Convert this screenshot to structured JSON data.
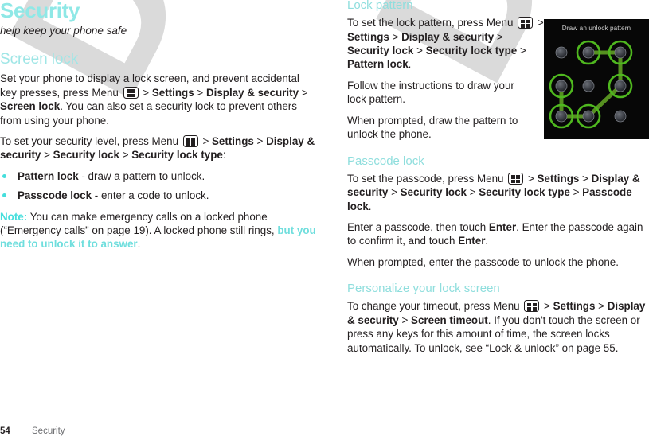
{
  "doc": {
    "title": "Security",
    "subtitle": "help keep your phone safe",
    "watermark": "DRAFT"
  },
  "colors": {
    "title_teal": "#8fe8e6",
    "section_teal": "#9fe6e6",
    "subsection_teal": "#8fdedd",
    "note_teal": "#45dedc",
    "bullet_teal": "#45dedc",
    "body_text": "#231f20",
    "footer_gray": "#6d6e71",
    "watermark_gray": "#d9d9d9",
    "figure_background": "#070707",
    "figure_green": "#6cb32a"
  },
  "icons": {
    "menu_key": "menu-key-icon"
  },
  "left_column": {
    "section_heading": "Screen lock",
    "paragraph_1": {
      "part_1": "Set your phone to display a lock screen, and prevent accidental key presses, press Menu ",
      "gt_1": " > ",
      "bold_1": "Settings",
      "gt_2": " > ",
      "bold_2": "Display & security",
      "gt_3": " > ",
      "bold_3": "Screen lock",
      "part_2": ". You can also set a security lock to prevent others from using your phone."
    },
    "paragraph_2": {
      "part_1": "To set your security level, press Menu ",
      "gt_1": " > ",
      "bold_1": "Settings",
      "gt_2": " > ",
      "bold_2": "Display & security",
      "gt_3": " > ",
      "bold_3": "Security lock",
      "gt_4": " > ",
      "bold_4": "Security lock type",
      "part_2": ":"
    },
    "bullets": [
      {
        "bold": "Pattern lock",
        "rest": " - draw a pattern to unlock."
      },
      {
        "bold": "Passcode lock",
        "rest": " - enter a code to unlock."
      }
    ],
    "note": {
      "label": "Note:",
      "part_1": " You can make emergency calls on a locked phone (“Emergency calls” on page 19). A locked phone still rings, ",
      "highlight": "but you need to unlock it to answer",
      "part_2": "."
    }
  },
  "right_column": {
    "lock_pattern": {
      "heading": "Lock pattern",
      "paragraph_1": {
        "part_1": "To set the lock pattern, press Menu ",
        "gt_1": " > ",
        "bold_1": "Settings",
        "gt_2": " > ",
        "bold_2": "Display & security",
        "gt_3": " > ",
        "bold_3": "Security lock",
        "gt_4": " > ",
        "bold_4": "Security lock type",
        "gt_5": " > ",
        "bold_5": "Pattern lock",
        "part_2": "."
      },
      "paragraph_2": "Follow the instructions to draw your lock pattern.",
      "paragraph_3": "When prompted, draw the pattern to unlock the phone."
    },
    "passcode_lock": {
      "heading": "Passcode lock",
      "paragraph_1": {
        "part_1": "To set the passcode, press Menu ",
        "gt_1": " > ",
        "bold_1": "Settings",
        "gt_2": " > ",
        "bold_2": "Display & security",
        "gt_3": " > ",
        "bold_3": "Security lock",
        "gt_4": " > ",
        "bold_4": "Security lock type",
        "gt_5": " > ",
        "bold_5": "Passcode lock",
        "part_2": "."
      },
      "paragraph_2": {
        "part_1": "Enter a passcode, then touch ",
        "bold_1": "Enter",
        "part_2": ". Enter the passcode again to confirm it, and touch ",
        "bold_2": "Enter",
        "part_3": "."
      },
      "paragraph_3": "When prompted, enter the passcode to unlock the phone."
    },
    "personalize": {
      "heading": "Personalize your lock screen",
      "paragraph_1": {
        "part_1": "To change your timeout, press Menu ",
        "gt_1": " > ",
        "bold_1": "Settings",
        "gt_2": " > ",
        "bold_2": "Display & security",
        "gt_3": " > ",
        "bold_3": "Screen timeout",
        "part_2": ". If you don't touch the screen or press any keys for this amount of time, the screen locks automatically. To unlock, see “Lock & unlock” on page 55."
      }
    }
  },
  "figure": {
    "caption": "Draw an unlock pattern",
    "pattern_sequence": [
      "top-middle",
      "top-right",
      "middle-right",
      "bottom-middle",
      "bottom-left",
      "middle-left"
    ],
    "unselected_dots": [
      "top-left",
      "middle-center",
      "bottom-right"
    ]
  },
  "footer": {
    "page_number": "54",
    "chapter": "Security"
  }
}
